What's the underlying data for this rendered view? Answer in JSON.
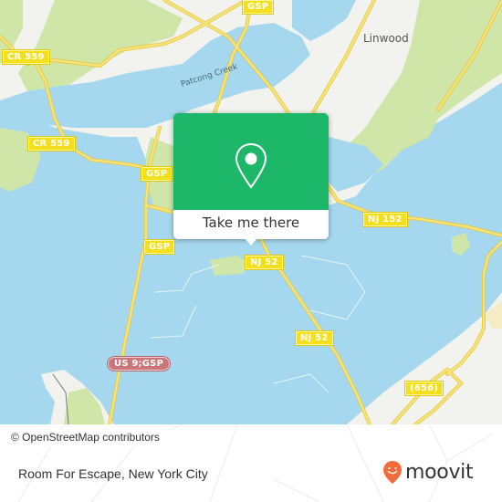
{
  "map": {
    "place_labels": [
      {
        "name": "Linwood"
      }
    ],
    "water_labels": [
      {
        "name": "Patcong Creek"
      }
    ],
    "road_shields": [
      {
        "id": "cr559-a",
        "label": "CR 559",
        "type": "county"
      },
      {
        "id": "cr559-b",
        "label": "CR 559",
        "type": "county"
      },
      {
        "id": "gsp-top",
        "label": "GSP",
        "type": "state"
      },
      {
        "id": "gsp-mid",
        "label": "GSP",
        "type": "state"
      },
      {
        "id": "gsp-low",
        "label": "GSP",
        "type": "state"
      },
      {
        "id": "nj152",
        "label": "NJ 152",
        "type": "state"
      },
      {
        "id": "nj52-a",
        "label": "NJ 52",
        "type": "state"
      },
      {
        "id": "nj52-b",
        "label": "NJ 52",
        "type": "state"
      },
      {
        "id": "us9gsp",
        "label": "US 9;GSP",
        "type": "us"
      },
      {
        "id": "cr656",
        "label": "(656)",
        "type": "county"
      }
    ],
    "attribution": "© OpenStreetMap contributors",
    "colors": {
      "water": "#a5d8ef",
      "land": "#f2f2ee",
      "park": "#cfe6a8",
      "road": "#f4df5c",
      "accent": "#1db76a"
    }
  },
  "popup": {
    "icon": "map-pin-icon",
    "cta_label": "Take me there"
  },
  "footer": {
    "title": "Room For Escape, New York City",
    "brand": "moovit",
    "brand_color": "#f26b3a"
  }
}
